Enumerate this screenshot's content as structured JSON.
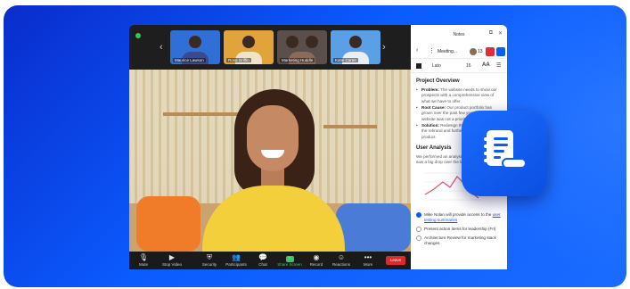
{
  "meeting": {
    "participants": [
      {
        "name": "Maurice Lawson",
        "color": "#2f6fd6"
      },
      {
        "name": "Rosa Griffin",
        "color": "#e0a43a"
      },
      {
        "name": "Marketing Huddle",
        "color": "#5a4f4a"
      },
      {
        "name": "Katie Carter",
        "color": "#5b9fe6"
      }
    ],
    "toolbar": {
      "mute": "Mute",
      "stop_video": "Stop Video",
      "security": "Security",
      "participants": "Participants",
      "chat": "Chat",
      "share_screen": "Share Screen",
      "record": "Record",
      "reactions": "Reactions",
      "more": "More",
      "leave": "Leave"
    }
  },
  "notes": {
    "panel_title": "Notes",
    "doc_title": "Meeting...",
    "participant_count": "13",
    "font": "Lato",
    "font_size": "16",
    "format_label": "AA",
    "project_heading": "Project Overview",
    "bullets": [
      {
        "label": "Problem:",
        "text": "The website needs to show our prospects with a comprehensive view of what we have to offer."
      },
      {
        "label": "Root Cause:",
        "text": "Our product portfolio has grown over the past few years and our website was not a priority."
      },
      {
        "label": "Solution:",
        "text": "Redesign the website to include the rebrand and further expression of the product."
      }
    ],
    "cursor_user": "John Chen",
    "analysis_heading": "User Analysis",
    "analysis_text": "We performed an analysis of conversions and saw a big drop over the last 9 months.",
    "tasks": [
      {
        "text": "Mike Nolan will provide access to the",
        "link": "user testing summaries",
        "checked": true
      },
      {
        "text": "Present action items for leadership (Fri)",
        "link": "",
        "checked": false
      },
      {
        "text": "Architecture Review for marketing stack changes",
        "link": "",
        "checked": false
      }
    ]
  },
  "colors": {
    "brand_blue": "#0b5cff",
    "record_red": "#e12d39",
    "leave_red": "#e02828",
    "share_green": "#36c96a",
    "cursor_purple": "#7b55e0"
  },
  "icons": [
    "mic-icon",
    "video-icon",
    "shield-icon",
    "participants-icon",
    "chat-icon",
    "share-screen-icon",
    "record-icon",
    "reactions-icon",
    "more-icon",
    "notes-app-icon"
  ]
}
